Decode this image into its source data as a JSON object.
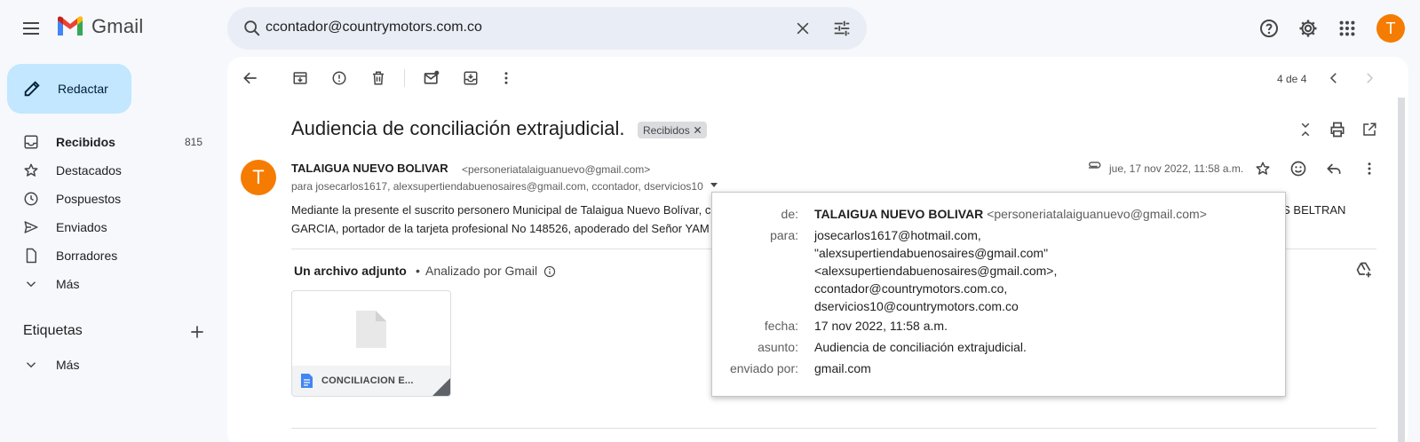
{
  "app": {
    "name": "Gmail"
  },
  "search": {
    "value": "ccontador@countrymotors.com.co"
  },
  "account": {
    "avatar_letter": "T",
    "avatar_color": "#f57c00"
  },
  "sidebar": {
    "compose_label": "Redactar",
    "items": [
      {
        "label": "Recibidos",
        "count": "815",
        "icon": "inbox-icon",
        "active": true
      },
      {
        "label": "Destacados",
        "count": "",
        "icon": "star-icon"
      },
      {
        "label": "Pospuestos",
        "count": "",
        "icon": "clock-icon"
      },
      {
        "label": "Enviados",
        "count": "",
        "icon": "send-icon"
      },
      {
        "label": "Borradores",
        "count": "",
        "icon": "draft-icon"
      },
      {
        "label": "Más",
        "count": "",
        "icon": "chevron-down-icon"
      }
    ],
    "labels_title": "Etiquetas",
    "labels_more": "Más"
  },
  "toolbar": {
    "pager": "4 de 4"
  },
  "message": {
    "subject": "Audiencia de conciliación extrajudicial.",
    "tag": "Recibidos",
    "sender_initial": "T",
    "sender_name": "TALAIGUA NUEVO BOLIVAR",
    "sender_email": "<personeriatalaiguanuevo@gmail.com>",
    "recipients": "para josecarlos1617, alexsupertiendabuenosaires@gmail.com, ccontador, dservicios10",
    "date": "jue, 17 nov 2022, 11:58 a.m.",
    "body_line1": "Mediante la presente el suscrito personero Municipal de Talaigua Nuevo Bolívar, c",
    "body_line1_end": "OS BELTRAN",
    "body_line2": "GARCIA, portador de la tarjeta profesional No 148526, apoderado del Señor YAM"
  },
  "attachments": {
    "title": "Un archivo adjunto",
    "separator": "•",
    "scan": "Analizado por Gmail",
    "file_name": "CONCILIACION E..."
  },
  "details": {
    "from_label": "de:",
    "from_name": "TALAIGUA NUEVO BOLIVAR",
    "from_email": "<personeriatalaiguanuevo@gmail.com>",
    "to_label": "para:",
    "to_lines": [
      "josecarlos1617@hotmail.com,",
      "\"alexsupertiendabuenosaires@gmail.com\"",
      "<alexsupertiendabuenosaires@gmail.com>,",
      "ccontador@countrymotors.com.co,",
      "dservicios10@countrymotors.com.co"
    ],
    "date_label": "fecha:",
    "date_value": "17 nov 2022, 11:58 a.m.",
    "subject_label": "asunto:",
    "subject_value": "Audiencia de conciliación extrajudicial.",
    "sent_by_label": "enviado por:",
    "sent_by_value": "gmail.com"
  }
}
